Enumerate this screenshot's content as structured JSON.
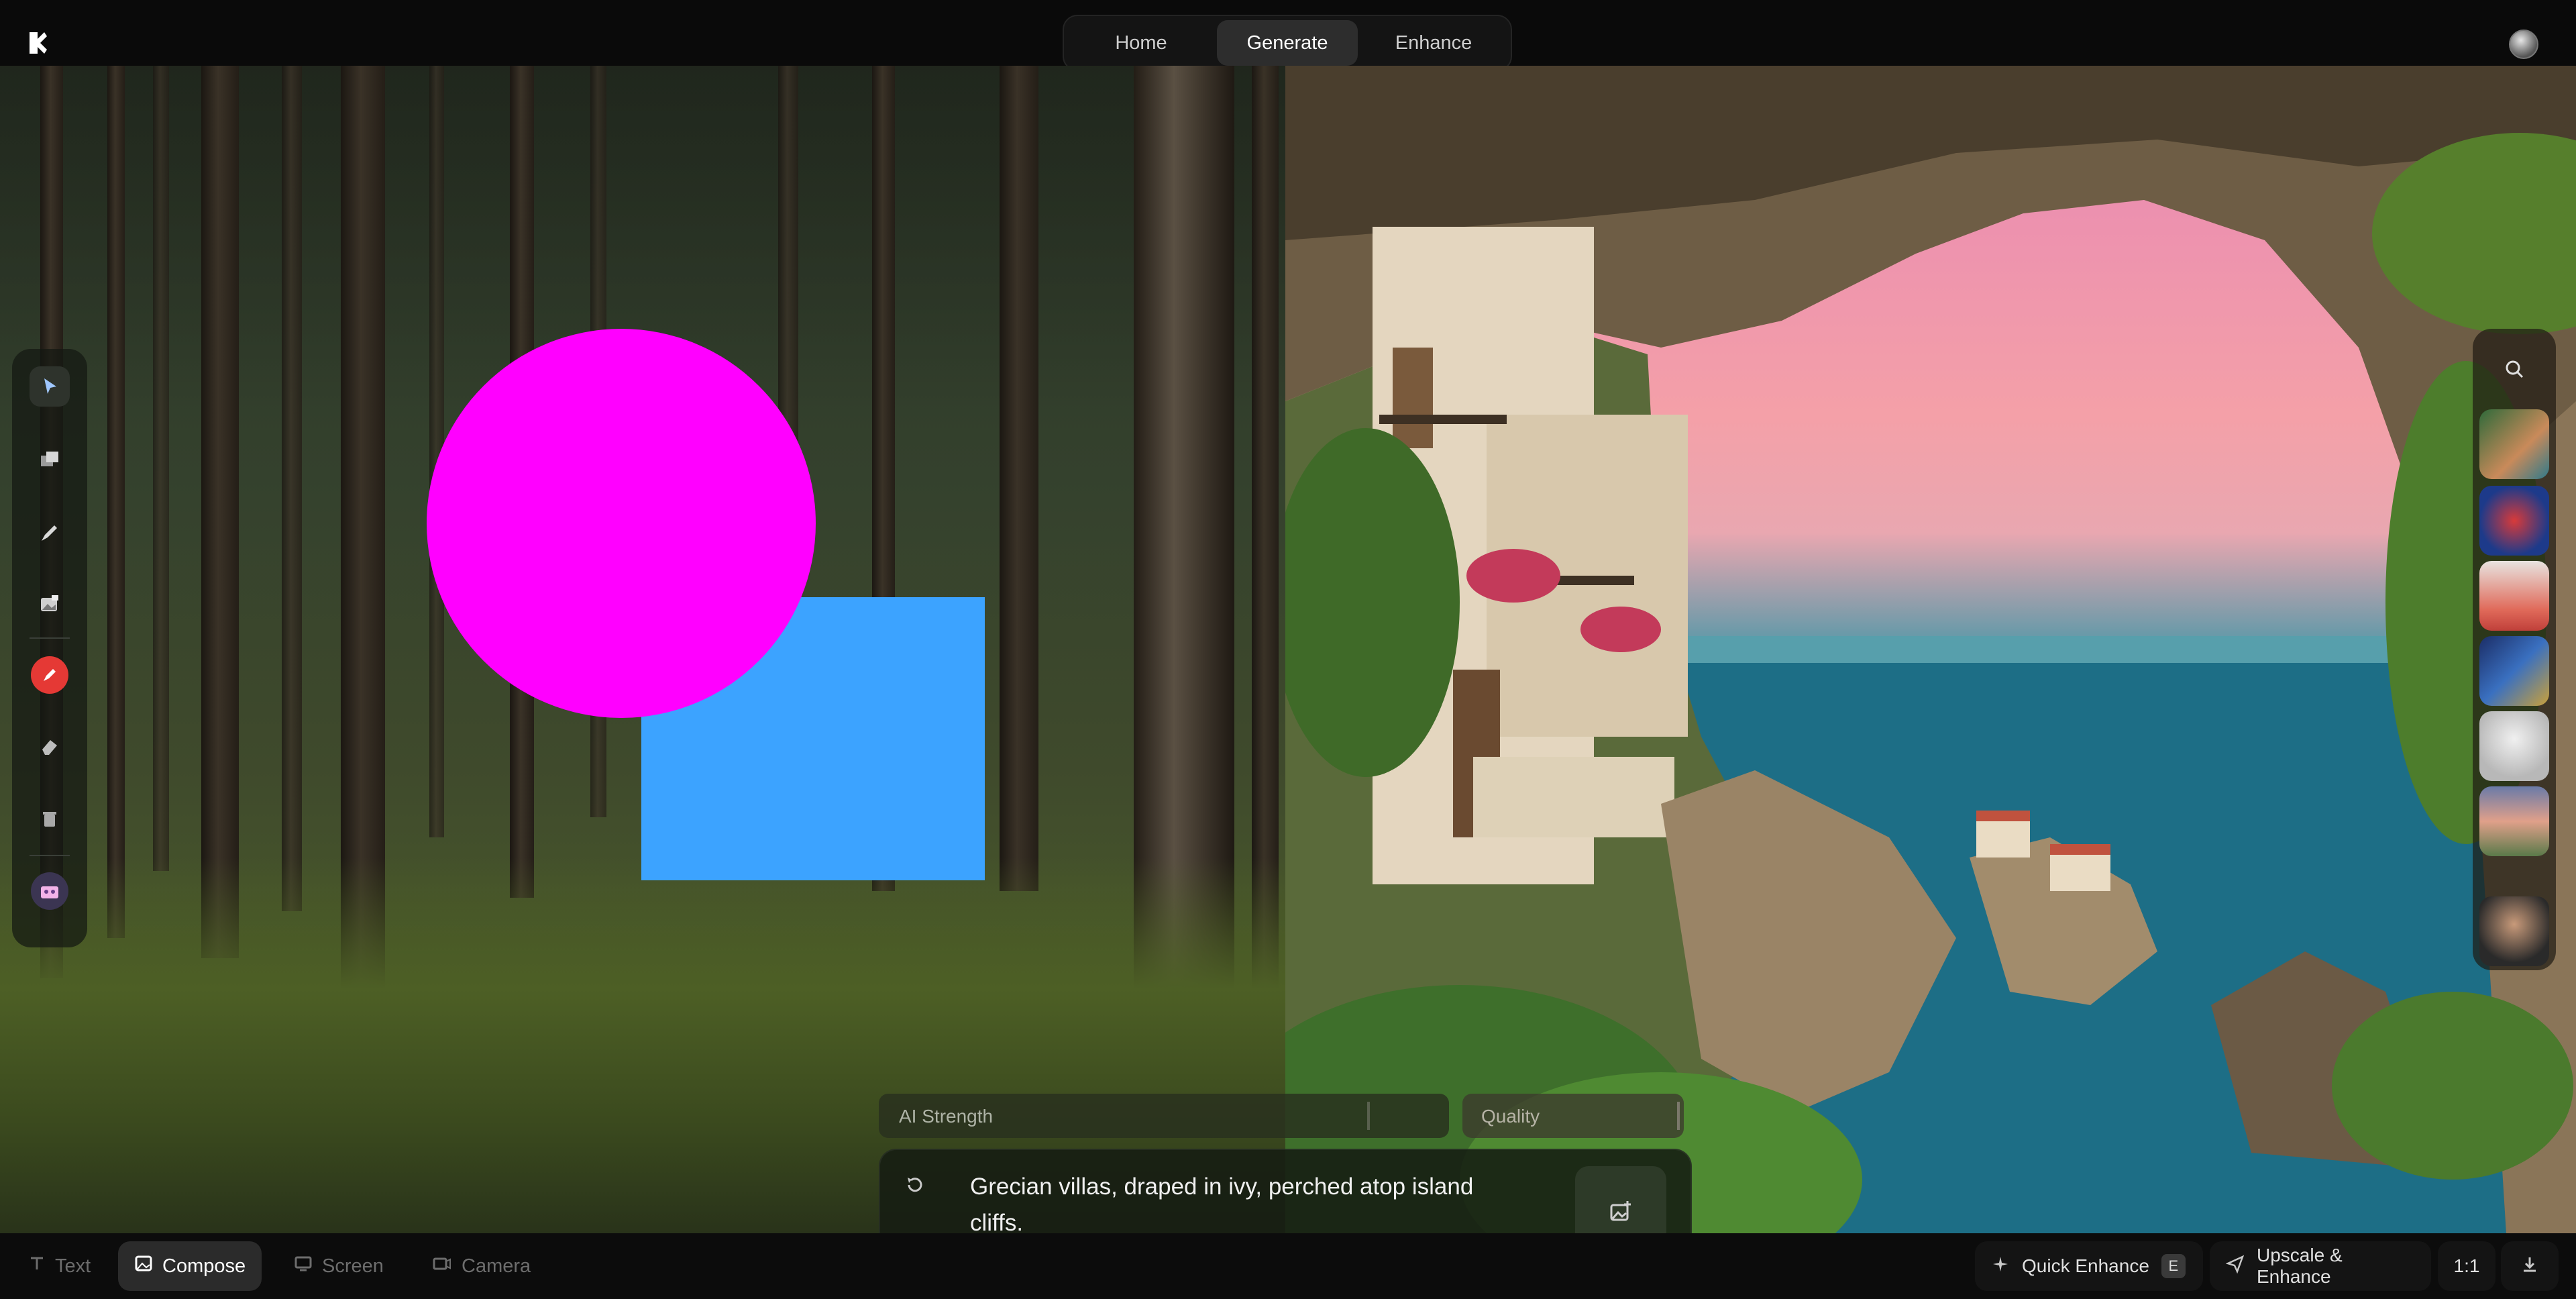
{
  "nav": {
    "tabs": [
      {
        "label": "Home"
      },
      {
        "label": "Generate"
      },
      {
        "label": "Enhance"
      }
    ],
    "active_tab": "Generate"
  },
  "toolbar": {
    "tools": [
      "select-icon",
      "layers-icon",
      "pen-icon",
      "image-import-icon",
      "brush-color-icon",
      "eraser-icon",
      "trash-icon",
      "style-preset-icon"
    ],
    "brush_color": "#e53935"
  },
  "canvas": {
    "shapes": [
      {
        "kind": "circle",
        "color": "#ff00ff"
      },
      {
        "kind": "rectangle",
        "color": "#3ca3ff"
      }
    ]
  },
  "controls": {
    "ai_strength_label": "AI Strength",
    "quality_label": "Quality"
  },
  "prompt": {
    "text": "Grecian villas, draped in ivy, perched atop island cliffs."
  },
  "modes": [
    {
      "label": "Text",
      "icon": "text-icon"
    },
    {
      "label": "Compose",
      "icon": "image-icon"
    },
    {
      "label": "Screen",
      "icon": "screen-icon"
    },
    {
      "label": "Camera",
      "icon": "camera-icon"
    }
  ],
  "actions": {
    "quick_enhance": "Quick Enhance",
    "quick_enhance_key": "E",
    "upscale_enhance": "Upscale & Enhance",
    "aspect_ratio": "1:1"
  }
}
